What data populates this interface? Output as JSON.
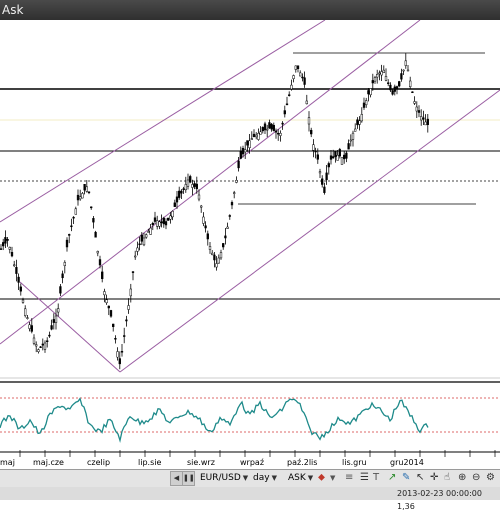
{
  "window": {
    "title": "Ask"
  },
  "chart": {
    "x_labels": [
      "maj",
      "maj.cze",
      "czelip",
      "lip.sie",
      "sie.wrz",
      "wrpaź",
      "paź.2lis",
      "lis.gru",
      "gru2014"
    ],
    "colors": {
      "channel": "#9b5fa3",
      "price": "#000000",
      "oscillator": "#1e8a8a",
      "oscillator_level": "#d23a3a",
      "hline": "#000000",
      "dotted": "#555555"
    }
  },
  "toolbar": {
    "pair": "EUR/USD",
    "timeframe": "day",
    "price_type": "ASK",
    "icons": [
      "pause-icon",
      "prev-icon",
      "pair-dropdown",
      "timeframe-dropdown",
      "price-type-dropdown",
      "indicator-icon",
      "lines-icon",
      "cursor-icon",
      "crosshair-icon",
      "zoom-in-icon",
      "zoom-out-icon",
      "scroll-left-icon",
      "scroll-right-icon"
    ]
  },
  "status": {
    "text": "2013-02-23 00:00:00  1,36"
  }
}
